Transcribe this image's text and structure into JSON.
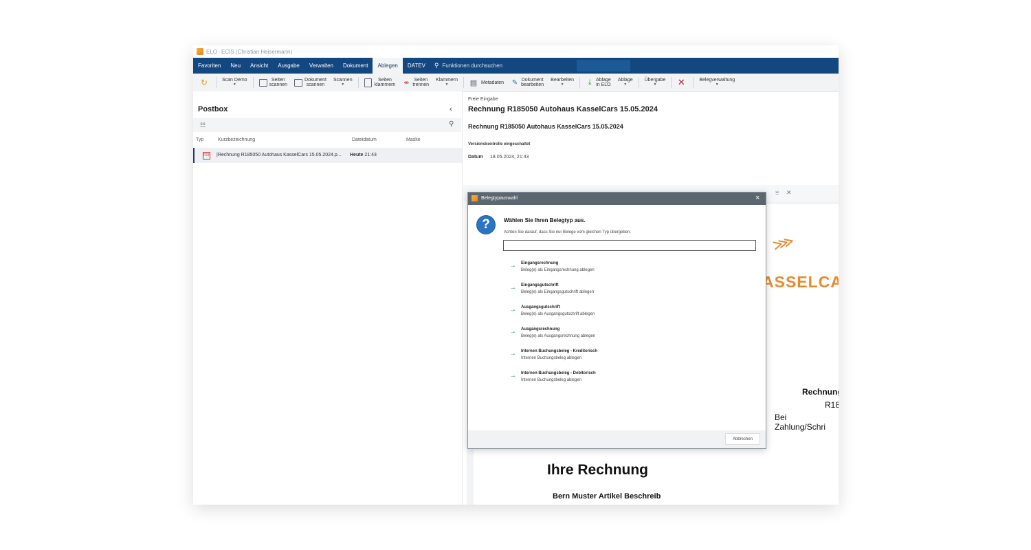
{
  "window": {
    "app_name": "ELO",
    "user": "ECIS (Christian Heisermann)"
  },
  "ribbon": {
    "tabs": [
      "Favoriten",
      "Neu",
      "Ansicht",
      "Ausgabe",
      "Verwalten",
      "Dokument",
      "Ablegen",
      "DATEV"
    ],
    "active_tab": "Ablegen",
    "search_label": "Funktionen durchsuchen"
  },
  "toolbar": {
    "scan_demo": "Scan Demo",
    "seiten_scannen_1": "Seiten",
    "seiten_scannen_2": "scannen",
    "dokument_scannen_1": "Dokument",
    "dokument_scannen_2": "scannen",
    "scannen": "Scannen",
    "seiten_klammern_1": "Seiten",
    "seiten_klammern_2": "klammern",
    "seiten_trennen_1": "Seiten",
    "seiten_trennen_2": "trennen",
    "klammern": "Klammern",
    "metadaten": "Metadaten",
    "dokument_bearbeiten_1": "Dokument",
    "dokument_bearbeiten_2": "bearbeiten",
    "bearbeiten": "Bearbeiten",
    "ablage_in_elo_1": "Ablage",
    "ablage_in_elo_2": "in ELO",
    "ablage": "Ablage",
    "uebergabe": "Übergabe",
    "belegverwaltung": "Belegverwaltung"
  },
  "postbox": {
    "title": "Postbox",
    "columns": {
      "typ": "Typ",
      "kurzbezeichnung": "Kurzbezeichnung",
      "dateidatum": "Dateidatum",
      "maske": "Maske"
    },
    "row": {
      "name": "|Rechnung R185050 Autohaus KasselCars 15.05.2024.p...",
      "date_prefix": "Heute",
      "time": "21:43"
    }
  },
  "details": {
    "label": "Freie Eingabe",
    "title": "Rechnung R185050 Autohaus KasselCars 15.05.2024",
    "subtitle": "Rechnung R185050 Autohaus KasselCars 15.05.2024",
    "version_control": "Versionskontrolle eingeschaltet",
    "date_label": "Datum",
    "date_value": "18.05.2024, 21:43"
  },
  "document_preview": {
    "brand": "ASSELCA",
    "info_line1": "Rechnung",
    "info_line2": "R18",
    "info_line3": "Bei Zahlung/Schri",
    "heading": "Ihre Rechnung",
    "cut_line": "Bern Muster   Artikel   Beschreib"
  },
  "dialog": {
    "title": "Belegtypauswahl",
    "heading": "Wählen Sie Ihren Belegtyp aus.",
    "hint": "Achten Sie darauf, dass Sie nur Belege vom gleichen Typ übergeben.",
    "input_value": "",
    "options": [
      {
        "title": "Eingangsrechnung",
        "desc": "Beleg(e) als Eingangsrechnung ablegen"
      },
      {
        "title": "Eingangsgutschrift",
        "desc": "Beleg(e) als Eingangsgutschrift ablegen"
      },
      {
        "title": "Ausgangsgutschrift",
        "desc": "Beleg(e) als Ausgangsgutschrift ablegen"
      },
      {
        "title": "Ausgangsrechnung",
        "desc": "Beleg(e) als Ausgangsrechnung ablegen"
      },
      {
        "title": "Internen Buchungsbeleg - Kreditorisch",
        "desc": "Internen Buchungsbeleg ablegen"
      },
      {
        "title": "Internen Buchungsbeleg - Debitorisch",
        "desc": "Internen Buchungsbeleg ablegen"
      }
    ],
    "cancel_label": "Abbrechen"
  },
  "colors": {
    "ribbon_blue": "#12477f",
    "accent_orange": "#e88a2f",
    "arrow_green": "#2d8a6b",
    "help_blue": "#2a74c4"
  },
  "icons": [
    "refresh-icon",
    "scanner-icon",
    "staple-icon",
    "split-icon",
    "table-icon",
    "edit-icon",
    "download-icon",
    "close-x-icon",
    "search-icon",
    "grid-icon",
    "pdf-icon",
    "help-icon",
    "arrow-right-icon"
  ]
}
